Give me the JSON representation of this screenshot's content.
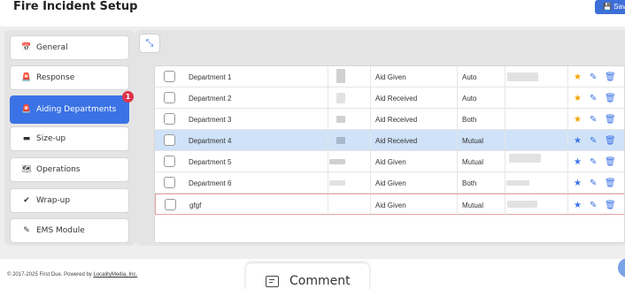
{
  "header": {
    "title": "Fire Incident Setup",
    "save_label": "💾 Save"
  },
  "sidebar": {
    "items": [
      {
        "label": "General",
        "icon": "calendar-icon",
        "glyph": "📅"
      },
      {
        "label": "Response",
        "icon": "siren-icon",
        "glyph": "🚨"
      },
      {
        "label": "Aiding Departments",
        "icon": "siren-icon",
        "glyph": "🚨",
        "active": true,
        "badge": "1"
      },
      {
        "label": "Size-up",
        "icon": "id-card-icon",
        "glyph": "▬"
      },
      {
        "label": "Operations",
        "icon": "map-icon",
        "glyph": "🗺"
      },
      {
        "label": "Wrap-up",
        "icon": "check-circle-icon",
        "glyph": "✔"
      },
      {
        "label": "EMS Module",
        "icon": "syringe-icon",
        "glyph": "✎"
      }
    ]
  },
  "table": {
    "rows": [
      {
        "department": "Department 1",
        "aid_type": "Aid Given",
        "mode": "Auto"
      },
      {
        "department": "Department 2",
        "aid_type": "Aid Received",
        "mode": "Auto"
      },
      {
        "department": "Department 3",
        "aid_type": "Aid Received",
        "mode": "Both"
      },
      {
        "department": "Department 4",
        "aid_type": "Aid Received",
        "mode": "Mutual",
        "selected": true
      },
      {
        "department": "Department 5",
        "aid_type": "Aid Given",
        "mode": "Mutual"
      },
      {
        "department": "Department 6",
        "aid_type": "Aid Given",
        "mode": "Both"
      },
      {
        "department": "gfgf",
        "aid_type": "Aid Given",
        "mode": "Mutual",
        "editing": true
      }
    ]
  },
  "footer": {
    "copyright": "© 2017-2025 First Due. Powered by ",
    "link_text": "LocalityMedia, Inc."
  },
  "comment": {
    "label": "Comment"
  },
  "colors": {
    "accent": "#3b73e6",
    "badge": "#e0334a",
    "star": "#f0a500",
    "selected_row": "#cfe2f8"
  }
}
